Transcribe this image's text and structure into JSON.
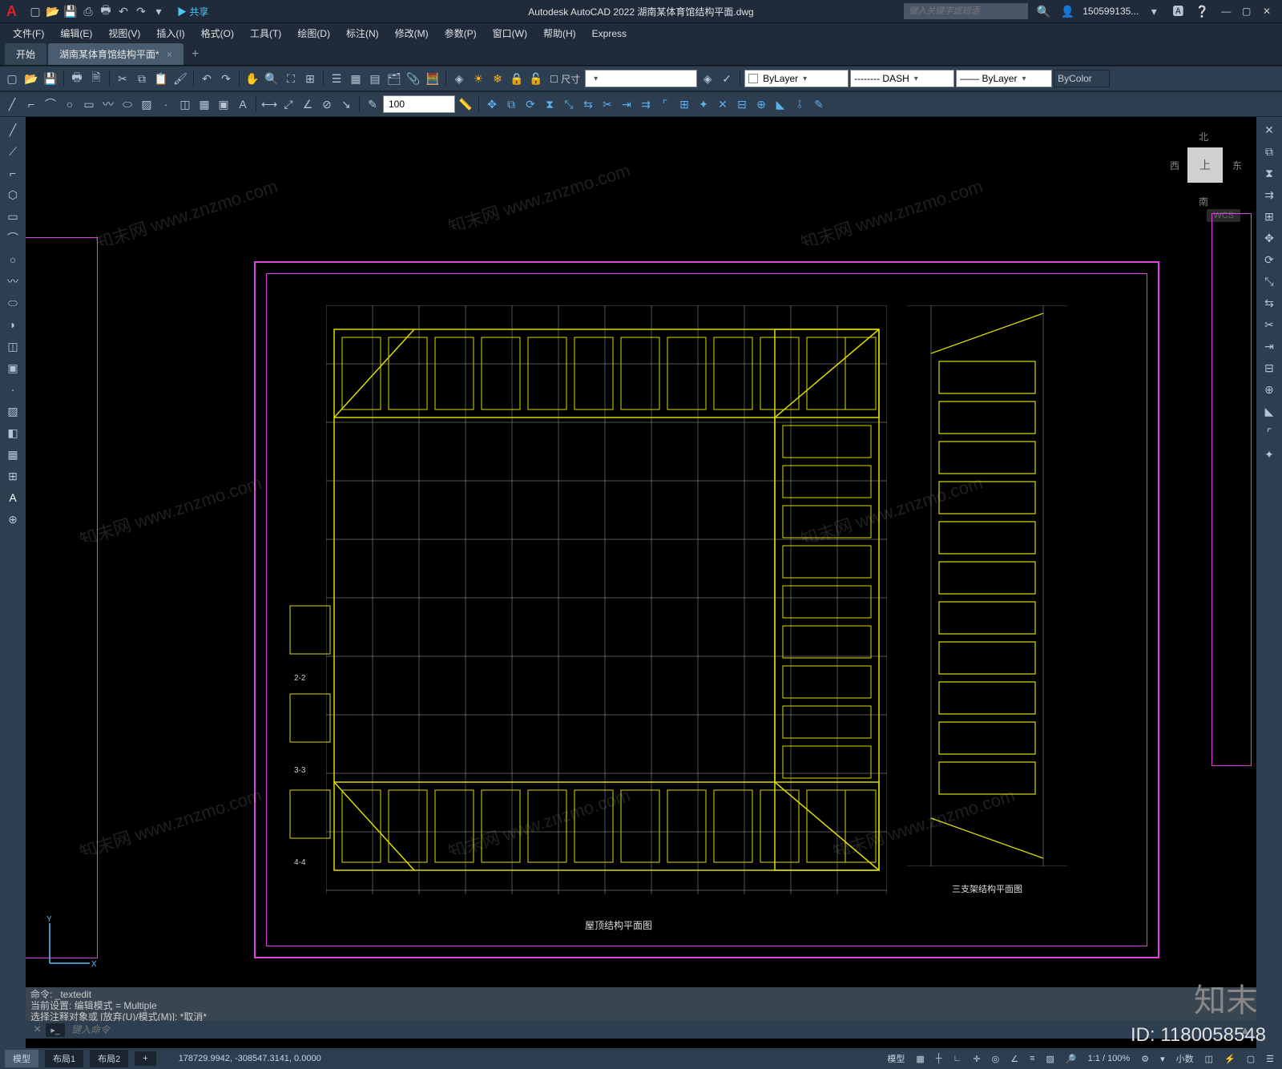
{
  "titlebar": {
    "app_logo": "A",
    "share": "▶ 共享",
    "title": "Autodesk AutoCAD 2022   湖南某体育馆结构平面.dwg",
    "search_placeholder": "键入关键字或短语",
    "user": "150599135...",
    "qat_icons": [
      "new-icon",
      "open-icon",
      "save-icon",
      "saveas-icon",
      "print-icon",
      "undo-icon",
      "redo-icon",
      "workspace-icon"
    ]
  },
  "menus": [
    "文件(F)",
    "编辑(E)",
    "视图(V)",
    "插入(I)",
    "格式(O)",
    "工具(T)",
    "绘图(D)",
    "标注(N)",
    "修改(M)",
    "参数(P)",
    "窗口(W)",
    "帮助(H)",
    "Express"
  ],
  "doc_tabs": {
    "start": "开始",
    "active": "湖南某体育馆结构平面*"
  },
  "toolbar1": {
    "dim_label": "尺寸",
    "linescale": "100",
    "layer_label": "ByLayer",
    "linetype_label": "-------- DASH",
    "lineweight_label": "—— ByLayer",
    "color_label": "ByColor"
  },
  "viewcube": {
    "n": "北",
    "s": "南",
    "e": "东",
    "w": "西",
    "top": "上",
    "wcs": "WCS"
  },
  "drawing": {
    "main_title": "屋顶结构平面图",
    "side_title": "三支架结构平面图",
    "detail_labels": [
      "2-2",
      "3-3",
      "4-4"
    ]
  },
  "command": {
    "hist1": "命令: _textedit",
    "hist2": "当前设置: 编辑模式 = Multiple",
    "hist3": "选择注释对象或 [放弃(U)/模式(M)]: *取消*",
    "placeholder": "键入命令"
  },
  "layout_tabs": [
    "模型",
    "布局1",
    "布局2"
  ],
  "status": {
    "coords": "178729.9942, -308547.3141, 0.0000",
    "model_btn": "模型",
    "grid_btn": "▦",
    "scale": "1:1 / 100%",
    "decimal": "小数",
    "plus_btn": "+"
  },
  "watermark": {
    "logo": "知末",
    "id": "ID: 1180058548",
    "diag": "知末网 www.znzmo.com"
  }
}
